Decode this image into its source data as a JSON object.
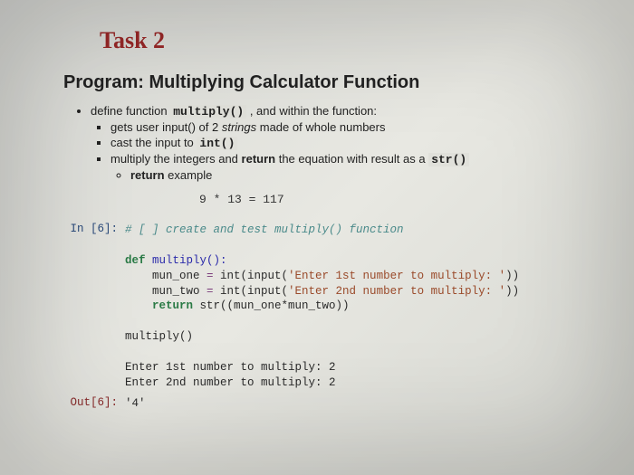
{
  "task_title": "Task 2",
  "program_title": "Program: Multiplying Calculator Function",
  "bullets": {
    "b1a": "define function ",
    "b1_code": "multiply()",
    "b1b": " , and within the function:",
    "b2a": "gets user input() of 2 ",
    "b2_em": "strings",
    "b2b": " made of whole numbers",
    "b3a": "cast the input to ",
    "b3_code": "int()",
    "b4a": "multiply the integers and ",
    "b4_bold": "return",
    "b4b": " the equation with result as a ",
    "b4_code": "str()",
    "b5_bold": "return",
    "b5b": " example"
  },
  "example": "9 * 13 = 117",
  "nb": {
    "in_prompt": "In [6]:",
    "out_prompt": "Out[6]:",
    "comment": "# [ ] create and test multiply() function",
    "l_def_kw": "def",
    "l_def_name": " multiply():",
    "l_m1a": "    mun_one ",
    "l_eq": "=",
    "l_m1b": " int(input(",
    "l_m1_str": "'Enter 1st number to multiply: '",
    "l_m1c": "))",
    "l_m2a": "    mun_two ",
    "l_m2b": " int(input(",
    "l_m2_str": "'Enter 2nd number to multiply: '",
    "l_m2c": "))",
    "l_ret_kw": "    return",
    "l_ret_body": " str((mun_one*mun_two))",
    "l_call": "multiply()",
    "out1": "Enter 1st number to multiply: 2",
    "out2": "Enter 2nd number to multiply: 2",
    "result": "'4'"
  }
}
